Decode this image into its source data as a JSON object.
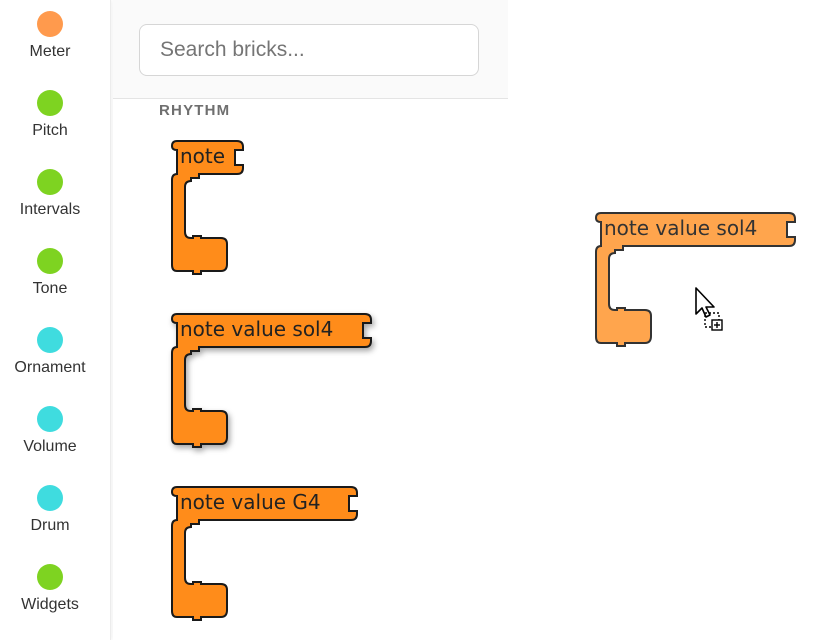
{
  "sidebar": {
    "categories": [
      {
        "label": "Meter",
        "color": "#ff9a4d"
      },
      {
        "label": "Pitch",
        "color": "#7ed321"
      },
      {
        "label": "Intervals",
        "color": "#7ed321"
      },
      {
        "label": "Tone",
        "color": "#7ed321"
      },
      {
        "label": "Ornament",
        "color": "#3fdcdf"
      },
      {
        "label": "Volume",
        "color": "#3fdcdf"
      },
      {
        "label": "Drum",
        "color": "#3fdcdf"
      },
      {
        "label": "Widgets",
        "color": "#7ed321"
      }
    ]
  },
  "search": {
    "placeholder": "Search bricks..."
  },
  "palette": {
    "section_title": "RHYTHM",
    "bricks": [
      {
        "label": "note",
        "color": "#ff8c1a"
      },
      {
        "label": "note value sol4",
        "color": "#ff8c1a"
      },
      {
        "label": "note value G4",
        "color": "#ff8c1a"
      }
    ]
  },
  "workspace": {
    "dragged_brick": {
      "label": "note value sol4",
      "color": "#ffa54d"
    },
    "cursor": "drag-copy-cursor-icon"
  }
}
